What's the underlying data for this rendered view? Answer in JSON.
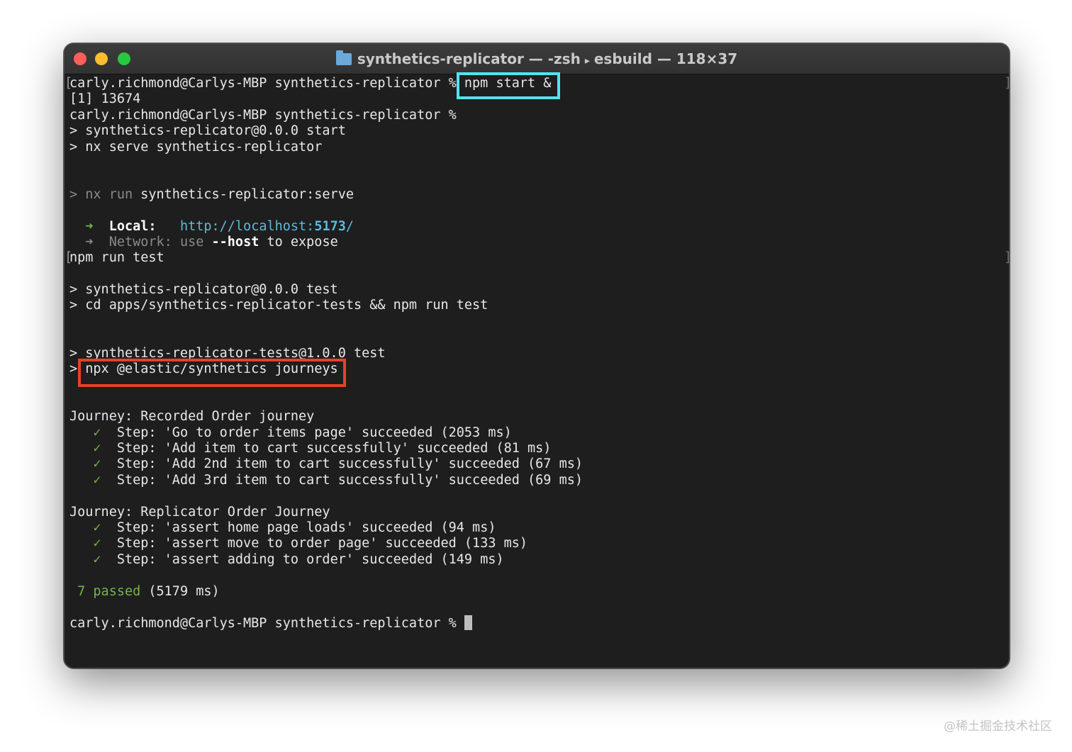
{
  "window": {
    "title_folder": "synthetics-replicator",
    "title_rest_1": "— -zsh",
    "title_rest_2": "esbuild — 118×37"
  },
  "terminal": {
    "l01_prompt": "carly.richmond@Carlys-MBP synthetics-replicator % ",
    "l01_cmd": "npm start &",
    "l02": "[1] 13674",
    "l03": "carly.richmond@Carlys-MBP synthetics-replicator %",
    "l04": "> synthetics-replicator@0.0.0 start",
    "l05": "> nx serve synthetics-replicator",
    "l06_dim": "> nx run ",
    "l06_bright": "synthetics-replicator:serve",
    "l07_arrow": "  ➜  ",
    "l07_label": "Local:",
    "l07_url_a": "http://localhost:",
    "l07_url_port": "5173",
    "l07_url_b": "/",
    "l08_arrow": "  ➜  ",
    "l08_label": "Network:",
    "l08_use": " use ",
    "l08_flag": "--host",
    "l08_rest": " to expose",
    "l09": "npm run test",
    "l10": "> synthetics-replicator@0.0.0 test",
    "l11": "> cd apps/synthetics-replicator-tests && npm run test",
    "l12": "> synthetics-replicator-tests@1.0.0 test",
    "l13_gt": "> ",
    "l13_cmd": "npx @elastic/synthetics journeys",
    "journey1_title": "Journey: Recorded Order journey",
    "journey1_steps": [
      "Step: 'Go to order items page' succeeded (2053 ms)",
      "Step: 'Add item to cart successfully' succeeded (81 ms)",
      "Step: 'Add 2nd item to cart successfully' succeeded (67 ms)",
      "Step: 'Add 3rd item to cart successfully' succeeded (69 ms)"
    ],
    "journey2_title": "Journey: Replicator Order Journey",
    "journey2_steps": [
      "Step: 'assert home page loads' succeeded (94 ms)",
      "Step: 'assert move to order page' succeeded (133 ms)",
      "Step: 'assert adding to order' succeeded (149 ms)"
    ],
    "check": "✓",
    "summary_passed": " 7 passed",
    "summary_time": " (5179 ms)",
    "final_prompt": "carly.richmond@Carlys-MBP synthetics-replicator % "
  },
  "watermark": "@稀土掘金技术社区",
  "colors": {
    "highlight_command": "#55e2f0",
    "highlight_npx": "#e8402a",
    "success_green": "#71b747",
    "link_cyan": "#5fb8de"
  }
}
